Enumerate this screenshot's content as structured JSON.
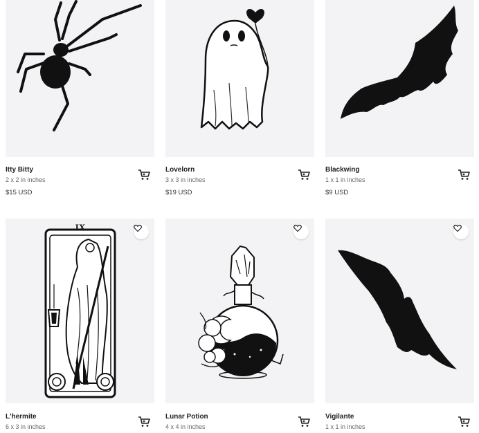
{
  "products": [
    {
      "name": "Itty Bitty",
      "size": "2 x 2 in inches",
      "price": "$15 USD",
      "image_icon": "spider-icon"
    },
    {
      "name": "Lovelorn",
      "size": "3 x 3 in inches",
      "price": "$19 USD",
      "image_icon": "ghost-with-heart-balloon-icon"
    },
    {
      "name": "Blackwing",
      "size": "1 x 1 in inches",
      "price": "$9 USD",
      "image_icon": "bat-icon"
    },
    {
      "name": "L'hermite",
      "size": "6 x 3 in inches",
      "price": "",
      "image_icon": "tarot-hermit-card-icon",
      "card_numeral": "IX"
    },
    {
      "name": "Lunar Potion",
      "size": "4 x 4 in inches",
      "price": "",
      "image_icon": "potion-bottle-icon"
    },
    {
      "name": "Vigilante",
      "size": "1 x 1 in inches",
      "price": "",
      "image_icon": "bat-icon"
    }
  ],
  "icons": {
    "cart": "shopping-cart-icon",
    "favorite": "heart-outline-icon"
  },
  "colors": {
    "image_bg": "#f3f3f5",
    "ink": "#111111"
  }
}
